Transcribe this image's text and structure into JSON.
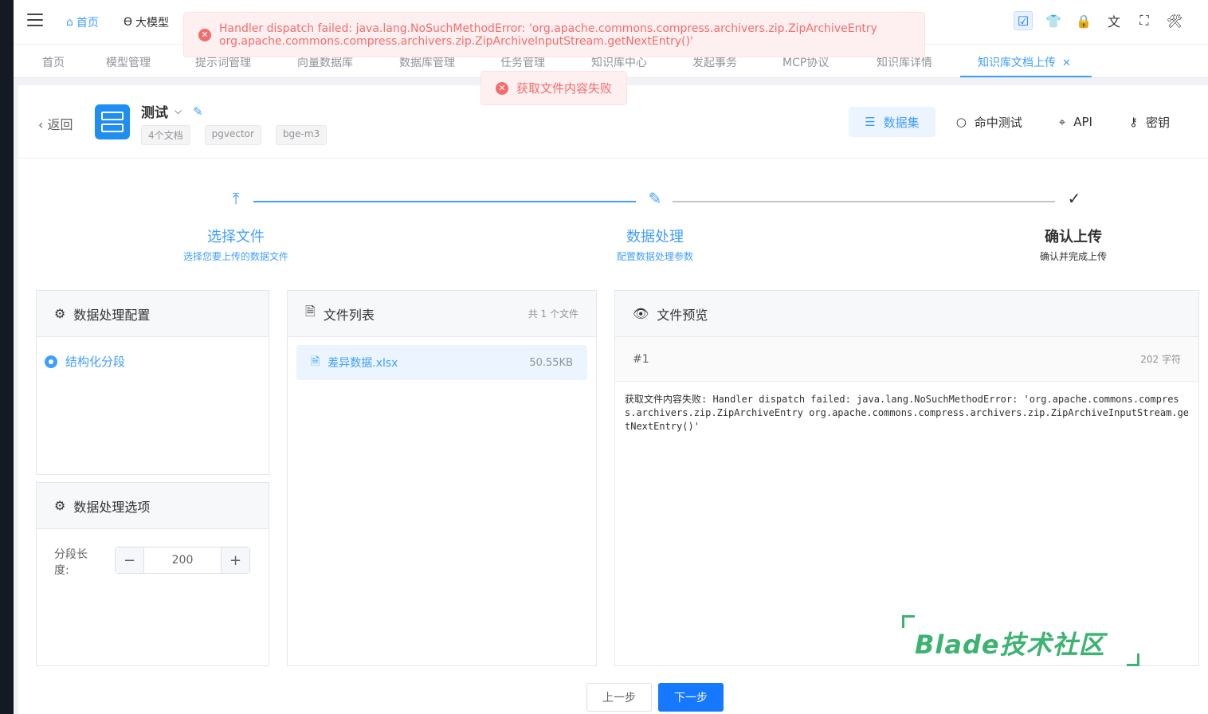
{
  "topbar": {
    "menu_home": "首页",
    "menu_llm": "大模型"
  },
  "tabs": [
    {
      "label": "首页"
    },
    {
      "label": "模型管理"
    },
    {
      "label": "提示词管理"
    },
    {
      "label": "向量数据库"
    },
    {
      "label": "数据库管理"
    },
    {
      "label": "任务管理"
    },
    {
      "label": "知识库中心"
    },
    {
      "label": "发起事务"
    },
    {
      "label": "MCP协议"
    },
    {
      "label": "知识库详情"
    },
    {
      "label": "知识库文档上传",
      "active": true
    }
  ],
  "toasts": {
    "big_line1": "Handler dispatch failed: java.lang.NoSuchMethodError: 'org.apache.commons.compress.archivers.zip.ZipArchiveEntry",
    "big_line2": "org.apache.commons.compress.archivers.zip.ZipArchiveInputStream.getNextEntry()'",
    "small": "获取文件内容失败"
  },
  "header": {
    "back_label": "返回",
    "kb_name": "测试",
    "tags": [
      "4个文档",
      "pgvector",
      "bge-m3"
    ],
    "actions": {
      "dataset": "数据集",
      "hit_test": "命中测试",
      "api": "API",
      "secret": "密钥"
    }
  },
  "steps": [
    {
      "title": "选择文件",
      "desc": "选择您要上传的数据文件",
      "state": "done"
    },
    {
      "title": "数据处理",
      "desc": "配置数据处理参数",
      "state": "active"
    },
    {
      "title": "确认上传",
      "desc": "确认并完成上传",
      "state": "pending"
    }
  ],
  "config_panel": {
    "title": "数据处理配置",
    "option": "结构化分段"
  },
  "options_panel": {
    "title": "数据处理选项",
    "seg_label": "分段长度:",
    "seg_value": "200"
  },
  "file_panel": {
    "title": "文件列表",
    "count": "共 1 个文件",
    "files": [
      {
        "name": "差异数据.xlsx",
        "size": "50.55KB"
      }
    ]
  },
  "preview_panel": {
    "title": "文件预览",
    "chunk_id": "#1",
    "chars": "202 字符",
    "content": "获取文件内容失败: Handler dispatch failed: java.lang.NoSuchMethodError: 'org.apache.commons.compress.archivers.zip.ZipArchiveEntry org.apache.commons.compress.archivers.zip.ZipArchiveInputStream.getNextEntry()'"
  },
  "footer": {
    "prev": "上一步",
    "next": "下一步"
  },
  "watermark": "Blade技术社区",
  "colors": {
    "primary": "#409eff",
    "error": "#f56c6c",
    "watermark": "#3cb371"
  }
}
